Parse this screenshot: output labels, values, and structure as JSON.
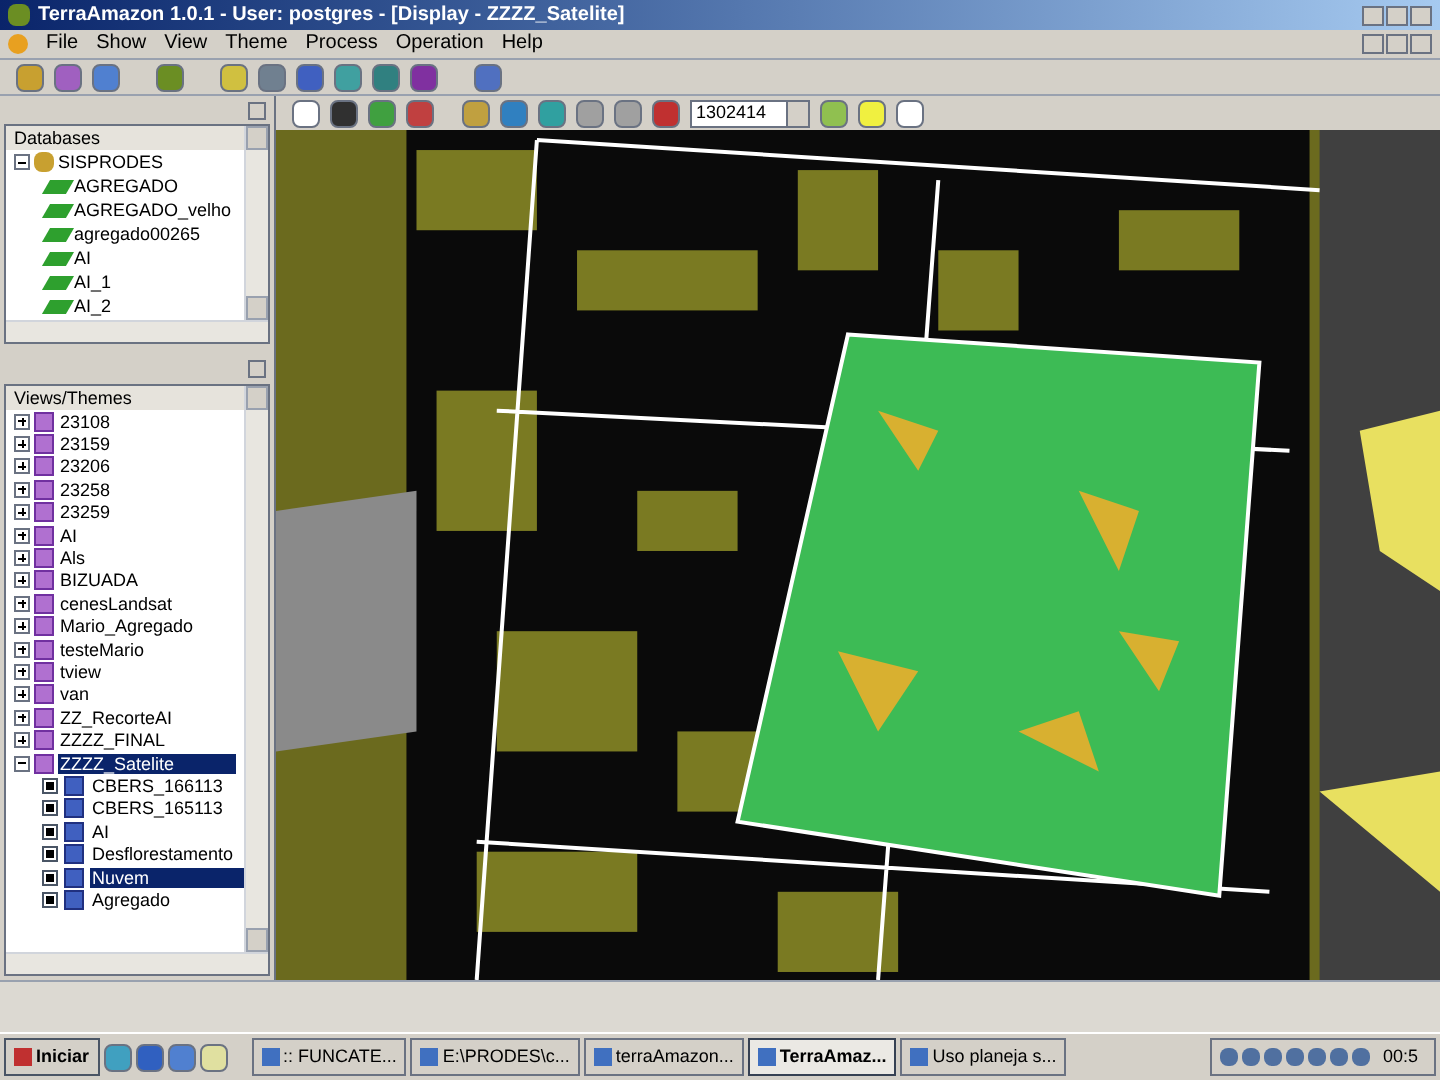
{
  "window": {
    "title": "TerraAmazon 1.0.1 - User: postgres - [Display - ZZZZ_Satelite]"
  },
  "menu": [
    "File",
    "Show",
    "View",
    "Theme",
    "Process",
    "Operation",
    "Help"
  ],
  "map_toolbar": {
    "combo_value": "1302414"
  },
  "databases": {
    "title": "Databases",
    "tree": [
      {
        "label": "SISPRODES",
        "expanded": true,
        "children": [
          {
            "label": "AGREGADO"
          },
          {
            "label": "AGREGADO_velho"
          },
          {
            "label": "agregado00265"
          },
          {
            "label": "AI"
          },
          {
            "label": "AI_1"
          },
          {
            "label": "AI_2"
          }
        ]
      }
    ]
  },
  "views": {
    "title": "Views/Themes",
    "tree": [
      {
        "label": "23108",
        "expanded": false,
        "selected": false
      },
      {
        "label": "23159",
        "expanded": false,
        "selected": false
      },
      {
        "label": "23206",
        "expanded": false,
        "selected": false
      },
      {
        "label": "23258",
        "expanded": false,
        "selected": false
      },
      {
        "label": "23259",
        "expanded": false,
        "selected": false
      },
      {
        "label": "AI",
        "expanded": false,
        "selected": false
      },
      {
        "label": "Als",
        "expanded": false,
        "selected": false
      },
      {
        "label": "BIZUADA",
        "expanded": false,
        "selected": false
      },
      {
        "label": "cenesLandsat",
        "expanded": false,
        "selected": false
      },
      {
        "label": "Mario_Agregado",
        "expanded": false,
        "selected": false
      },
      {
        "label": "testeMario",
        "expanded": false,
        "selected": false
      },
      {
        "label": "tview",
        "expanded": false,
        "selected": false
      },
      {
        "label": "van",
        "expanded": false,
        "selected": false
      },
      {
        "label": "ZZ_RecorteAI",
        "expanded": false,
        "selected": false
      },
      {
        "label": "ZZZZ_FINAL",
        "expanded": false,
        "selected": false
      },
      {
        "label": "ZZZZ_Satelite",
        "expanded": true,
        "selected": true,
        "children": [
          {
            "label": "CBERS_166113",
            "checked": true,
            "selected": false
          },
          {
            "label": "CBERS_165113",
            "checked": true,
            "selected": false
          },
          {
            "label": "AI",
            "checked": true,
            "selected": false
          },
          {
            "label": "Desflorestamento",
            "checked": true,
            "selected": false
          },
          {
            "label": "Nuvem",
            "checked": true,
            "selected": true
          },
          {
            "label": "Agregado",
            "checked": true,
            "selected": false
          }
        ]
      }
    ]
  },
  "taskbar": {
    "start": "Iniciar",
    "tasks": [
      {
        "label": ":: FUNCATE...",
        "selected": false
      },
      {
        "label": "E:\\PRODES\\c...",
        "selected": false
      },
      {
        "label": "terraAmazon...",
        "selected": false
      },
      {
        "label": "TerraAmaz...",
        "selected": true
      },
      {
        "label": "Uso planeja s...",
        "selected": false
      }
    ],
    "clock": "00:5"
  }
}
